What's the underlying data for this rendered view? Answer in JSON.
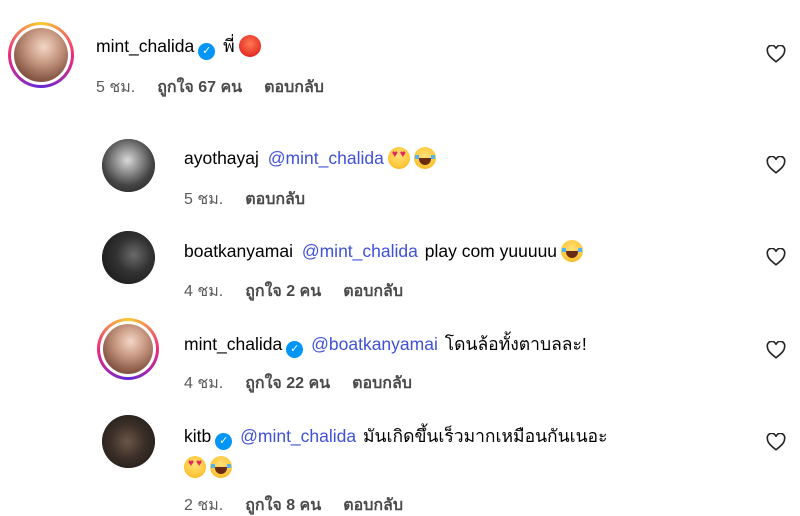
{
  "comments": [
    {
      "username": "mint_chalida",
      "verified": true,
      "text": "พี่",
      "emojis": [
        "angry-face-emoji"
      ],
      "time": "5 ชม.",
      "likes": "ถูกใจ 67 คน",
      "reply": "ตอบกลับ"
    },
    {
      "username": "ayothayaj",
      "verified": false,
      "mention": "@mint_chalida",
      "text": "",
      "emojis": [
        "heart-eyes-emoji",
        "laughing-tears-emoji"
      ],
      "time": "5 ชม.",
      "reply": "ตอบกลับ"
    },
    {
      "username": "boatkanyamai",
      "verified": false,
      "mention": "@mint_chalida",
      "text": "play com yuuuuu",
      "emojis": [
        "laughing-tears-emoji"
      ],
      "time": "4 ชม.",
      "likes": "ถูกใจ 2 คน",
      "reply": "ตอบกลับ"
    },
    {
      "username": "mint_chalida",
      "verified": true,
      "mention": "@boatkanyamai",
      "text": "โดนล้อทั้งตาบลละ!",
      "time": "4 ชม.",
      "likes": "ถูกใจ 22 คน",
      "reply": "ตอบกลับ"
    },
    {
      "username": "kitb",
      "verified": true,
      "mention": "@mint_chalida",
      "text": "มันเกิดขึ้นเร็วมากเหมือนกันเนอะ",
      "emojis": [
        "heart-eyes-emoji",
        "laughing-tears-emoji"
      ],
      "time": "2 ชม.",
      "likes": "ถูกใจ 8 คน",
      "reply": "ตอบกลับ"
    }
  ],
  "colors": {
    "mention": "#3f51d8",
    "verified": "#0095f6",
    "meta": "#5b5b5b"
  }
}
